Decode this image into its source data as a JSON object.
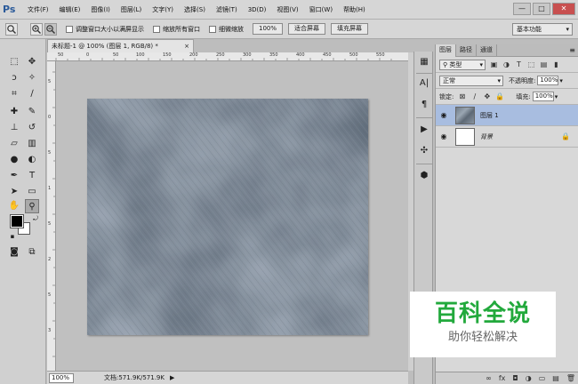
{
  "app": {
    "logo": "Ps",
    "menu": [
      "文件(F)",
      "编辑(E)",
      "图像(I)",
      "图层(L)",
      "文字(Y)",
      "选择(S)",
      "滤镜(T)",
      "3D(D)",
      "视图(V)",
      "窗口(W)",
      "帮助(H)"
    ],
    "window_controls": [
      "—",
      "□",
      "✕"
    ]
  },
  "options": {
    "resize_windows_label": "调整窗口大小以满屏显示",
    "zoom_all_label": "缩放所有窗口",
    "scrubby_zoom_label": "细微缩放",
    "zoom_100_label": "100%",
    "fit_screen_label": "适合屏幕",
    "fill_screen_label": "填充屏幕",
    "workspace": "基本功能"
  },
  "document": {
    "tab_title": "未标题-1 @ 100% (图层 1, RGB/8) *",
    "close": "×",
    "ruler_h_ticks": [
      "50",
      "0",
      "50",
      "100",
      "150",
      "200",
      "250",
      "300",
      "350",
      "400",
      "450",
      "500",
      "550"
    ],
    "ruler_v_ticks": [
      "5",
      "0",
      "5",
      "1",
      "5",
      "2",
      "5",
      "3"
    ],
    "zoom": "100%",
    "doc_info": "文档:571.9K/571.9K",
    "status_arrow": "▶"
  },
  "layers_panel": {
    "tabs": [
      "图层",
      "路径",
      "通道"
    ],
    "menu": "≡",
    "filter_kind": "类型",
    "blend_mode": "正常",
    "opacity_label": "不透明度:",
    "opacity_value": "100%",
    "lock_label": "锁定:",
    "fill_label": "填充:",
    "fill_value": "100%",
    "layers": [
      {
        "name": "图层 1",
        "selected": true
      },
      {
        "name": "背景",
        "selected": false,
        "locked": true
      }
    ],
    "footer_icons": [
      "∞",
      "fx",
      "◘",
      "◑",
      "▭",
      "▤",
      "🗑"
    ]
  },
  "watermark": {
    "title": "百科全说",
    "subtitle": "助你轻松解决",
    "title_color": "#22a93c"
  }
}
